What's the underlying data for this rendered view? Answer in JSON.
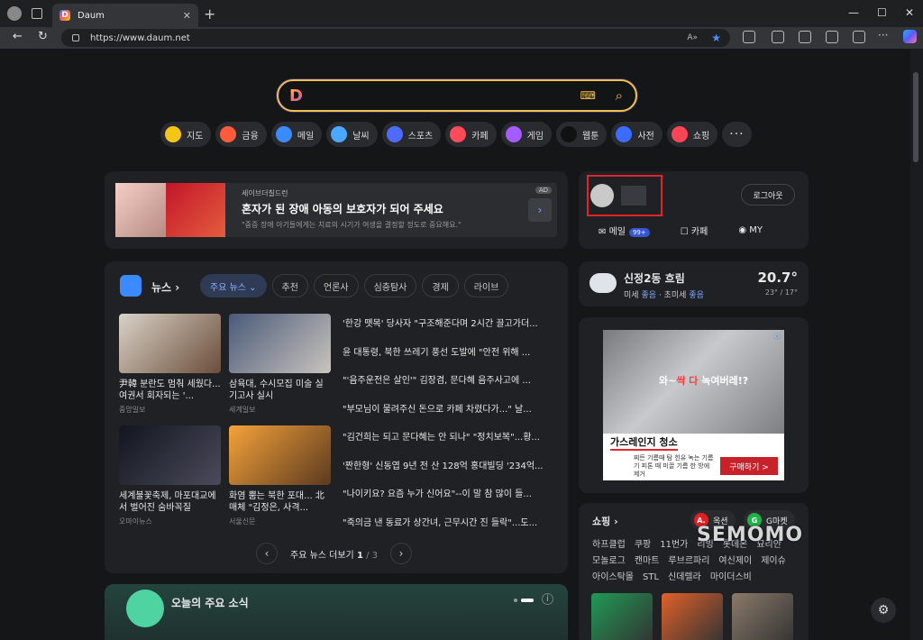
{
  "browser": {
    "tab_title": "Daum",
    "url": "https://www.daum.net"
  },
  "shortcuts": [
    {
      "label": "지도",
      "icon": "map-pin-icon",
      "color": "#f5c518"
    },
    {
      "label": "금융",
      "icon": "finance-icon",
      "color": "#ff5a3c"
    },
    {
      "label": "메일",
      "icon": "mail-icon",
      "color": "#3b8bff"
    },
    {
      "label": "날씨",
      "icon": "weather-icon",
      "color": "#4aa8ff"
    },
    {
      "label": "스포츠",
      "icon": "sports-icon",
      "color": "#4d6cff"
    },
    {
      "label": "카페",
      "icon": "cafe-icon",
      "color": "#ff4a5a"
    },
    {
      "label": "게임",
      "icon": "game-icon",
      "color": "#a45cff"
    },
    {
      "label": "웹툰",
      "icon": "webtoon-icon",
      "color": "#111111"
    },
    {
      "label": "사전",
      "icon": "dictionary-icon",
      "color": "#3b6cff"
    },
    {
      "label": "쇼핑",
      "icon": "shopping-icon",
      "color": "#ff4455"
    }
  ],
  "top_ad": {
    "org": "세이브더칠드런",
    "headline": "혼자가 된 장애 아동의 보호자가 되어 주세요",
    "sub": "\"중증 장애 아기들에게는 치료의 시기가 여생을 결정할 정도로 중요해요.\"",
    "badge": "AD"
  },
  "login": {
    "logout": "로그아웃",
    "mail_label": "메일",
    "mail_badge": "99+",
    "cafe_label": "카페",
    "my_label": "MY"
  },
  "news": {
    "title": "뉴스",
    "tabs": [
      "주요 뉴스",
      "추천",
      "언론사",
      "심층탐사",
      "경제",
      "라이브"
    ],
    "thumbs": [
      {
        "caption": "尹韓 분란도 멈춰 세웠다...여권서 회자되는 '...",
        "source": "중앙일보",
        "color1": "#d9d2c7",
        "color2": "#6b4e3a"
      },
      {
        "caption": "삼육대, 수시모집 미술 실기고사 실시",
        "source": "세계일보",
        "color1": "#4a5a7a",
        "color2": "#c9c4bd"
      },
      {
        "caption": "세계불꽃축제, 마포대교에서 벌어진 숨바꼭질",
        "source": "오마이뉴스",
        "color1": "#12161f",
        "color2": "#4b4a5a"
      },
      {
        "caption": "화염 뿜는 북한 포대... 北매체 \"김정은, 사격...",
        "source": "서울신문",
        "color1": "#f5a23a",
        "color2": "#5b3a1f"
      }
    ],
    "headlines": [
      "'한강 뗏목' 당사자 \"구조해준다며 2시간 끌고가더...",
      "윤 대통령, 북한 쓰레기 풍선 도발에 \"안전 위해 ...",
      "\"'음주운전은 살인'\" 김장겸, 문다혜 음주사고에 ...",
      "\"부모님이 물려주신 돈으로 카페 차렸다가...\" 날...",
      "\"김건희는 되고 문다혜는 안 되나\" \"정치보복\"...황...",
      "'짠한형' 신동엽 9년 전 산 128억 홍대빌딩 '234억...",
      "\"나이키요? 요즘 누가 신어요\"--이 말 참 많이 들...",
      "\"죽의금 낸 동료가 상간녀, 근무시간 진 들락\"...도..."
    ],
    "pager_label": "주요 뉴스 더보기",
    "page_current": "1",
    "page_total": "/ 3"
  },
  "today": {
    "title": "오늘의 주요 소식"
  },
  "weather": {
    "location": "신정2동 흐림",
    "dust_label": "미세",
    "dust_value": "좋음",
    "fine_dust_label": "· 초미세",
    "fine_dust_value": "좋음",
    "temp": "20.7°",
    "range": "23° / 17°"
  },
  "side_ad": {
    "overlay_pre": "와~",
    "overlay_red": "싹 다",
    "overlay_post": " 녹여버레!?",
    "product": "가스레인지 청소",
    "desc": "찌든 기름때 탐 힌유 녹는 기름기 피톤 때 미끌 기름 한 방에 제거",
    "buy": "구매하기 >",
    "close": "ⓧ"
  },
  "shop": {
    "title": "쇼핑",
    "mall1": "옥션",
    "mall2": "G마켓",
    "links": [
      "하프클럽",
      "쿠팡",
      "11번가",
      "리빙",
      "롯데온",
      "묘리안",
      "모놀로그",
      "캔마트",
      "루브르파리",
      "여신제이",
      "제이슈",
      "아이스탁몰",
      "STL",
      "신데렐라",
      "마이더스비"
    ],
    "products": [
      "#1f9a55",
      "#e0612a",
      "#8a7a6a"
    ]
  },
  "watermark": "SEMOMO"
}
